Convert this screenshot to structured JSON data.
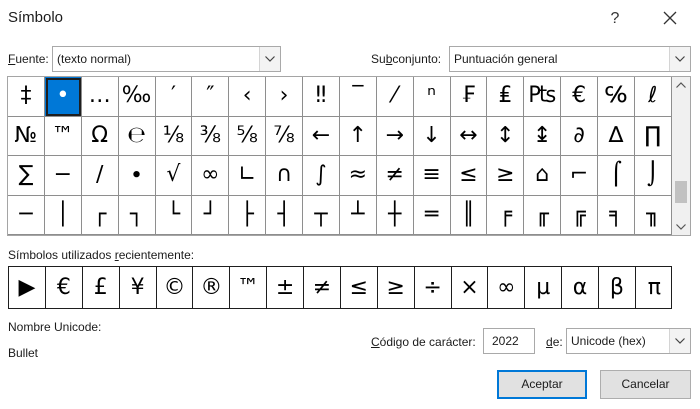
{
  "dialog": {
    "title": "Símbolo"
  },
  "font": {
    "label_hotkey": "F",
    "label_rest": "uente:",
    "value": "(texto normal)"
  },
  "subset": {
    "label_pre": "Su",
    "label_hotkey": "b",
    "label_post": "conjunto:",
    "value": "Puntuación general"
  },
  "grid": {
    "selected_index": 1,
    "symbols": [
      "‡",
      "•",
      "…",
      "‰",
      "′",
      "″",
      "‹",
      "›",
      "‼",
      "‾",
      "⁄",
      "ⁿ",
      "₣",
      "₤",
      "₧",
      "€",
      "℅",
      "ℓ",
      "№",
      "™",
      "Ω",
      "℮",
      "⅛",
      "⅜",
      "⅝",
      "⅞",
      "←",
      "↑",
      "→",
      "↓",
      "↔",
      "↕",
      "↨",
      "∂",
      "∆",
      "∏",
      "∑",
      "−",
      "∕",
      "∙",
      "√",
      "∞",
      "∟",
      "∩",
      "∫",
      "≈",
      "≠",
      "≡",
      "≤",
      "≥",
      "⌂",
      "⌐",
      "⌠",
      "⌡",
      "─",
      "│",
      "┌",
      "┐",
      "└",
      "┘",
      "├",
      "┤",
      "┬",
      "┴",
      "┼",
      "═",
      "║",
      "╒",
      "╓",
      "╔",
      "╕",
      "╖"
    ]
  },
  "recent": {
    "label_pre": "Símbolos utilizados ",
    "label_hotkey": "r",
    "label_post": "ecientemente:",
    "symbols": [
      "▶",
      "€",
      "£",
      "¥",
      "©",
      "®",
      "™",
      "±",
      "≠",
      "≤",
      "≥",
      "÷",
      "×",
      "∞",
      "µ",
      "α",
      "β",
      "π"
    ]
  },
  "unicode": {
    "label": "Nombre Unicode:",
    "name": "Bullet"
  },
  "char_code": {
    "label_hotkey": "C",
    "label_rest": "ódigo de carácter:",
    "value": "2022"
  },
  "from": {
    "label_hotkey": "d",
    "label_rest": "e:",
    "value": "Unicode (hex)"
  },
  "buttons": {
    "ok": "Aceptar",
    "cancel": "Cancelar"
  },
  "icons": {
    "help": "?",
    "close": "close-icon",
    "dropdown": "chevron-down-icon"
  }
}
